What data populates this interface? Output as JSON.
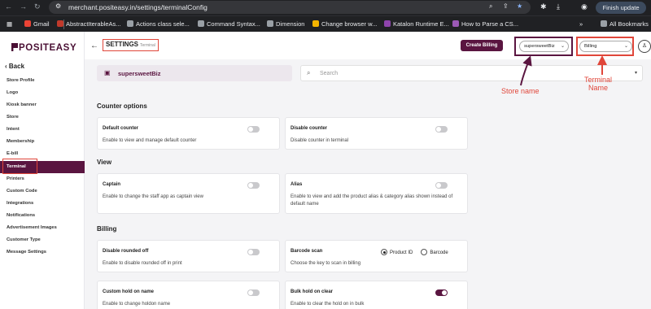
{
  "browser": {
    "url": "merchant.positeasy.in/settings/terminalConfig",
    "finish_update": "Finish update",
    "all_bookmarks": "All Bookmarks",
    "bookmarks": [
      {
        "label": "Gmail",
        "color": "#ea4335"
      },
      {
        "label": "AbstractIterableAs...",
        "color": "#c0392b"
      },
      {
        "label": "Actions class sele...",
        "color": "#9aa0a6"
      },
      {
        "label": "Command Syntax...",
        "color": "#9aa0a6"
      },
      {
        "label": "Dimension",
        "color": "#9aa0a6"
      },
      {
        "label": "Change browser w...",
        "color": "#f4b400"
      },
      {
        "label": "Katalon Runtime E...",
        "color": "#8e44ad"
      },
      {
        "label": "How to Parse a CS...",
        "color": "#9b59b6"
      }
    ]
  },
  "sidebar": {
    "logo": "POSITEASY",
    "back": "Back",
    "items": [
      "Store Profile",
      "Logo",
      "Kiosk banner",
      "Store",
      "Intent",
      "Membership",
      "E-bill",
      "Terminal",
      "Printers",
      "Custom Code",
      "Integrations",
      "Notifications",
      "Advertisement Images",
      "Customer Type",
      "Message Settings"
    ],
    "active": "Terminal"
  },
  "header": {
    "title": "SETTINGS",
    "subtitle": "Terminal",
    "create_billing": "Create Billing",
    "store_select": "supersweetBiz",
    "terminal_select": "Billing"
  },
  "store_pill": "supersweetBiz",
  "search": {
    "placeholder": "Search"
  },
  "sections": {
    "counter": "Counter options",
    "view": "View",
    "billing": "Billing"
  },
  "cards": {
    "default_counter": {
      "title": "Default counter",
      "desc": "Enable to view and manage default counter",
      "on": false
    },
    "disable_counter": {
      "title": "Disable counter",
      "desc": "Disable counter in terminal",
      "on": false
    },
    "captain": {
      "title": "Captain",
      "desc": "Enable to change the staff app as captain view",
      "on": false
    },
    "alias": {
      "title": "Alias",
      "desc": "Enable to view and add the product alias & category alias shown instead of default name",
      "on": false
    },
    "disable_rounded": {
      "title": "Disable rounded off",
      "desc": "Enable to disable rounded off in print",
      "on": false
    },
    "barcode": {
      "title": "Barcode scan",
      "desc": "Choose the key to scan in billing",
      "option1": "Product ID",
      "option2": "Barcode",
      "selected": "Product ID"
    },
    "custom_hold": {
      "title": "Custom hold on name",
      "desc": "Enable to change holdon name",
      "on": false
    },
    "bulk_hold": {
      "title": "Bulk hold on clear",
      "desc": "Enable to clear the hold on in bulk",
      "on": true
    }
  },
  "annotations": {
    "store_name": "Store name",
    "terminal_line1": "Terminal",
    "terminal_line2": "Name",
    "color": "#e0463a",
    "store_color": "#5a1540"
  }
}
